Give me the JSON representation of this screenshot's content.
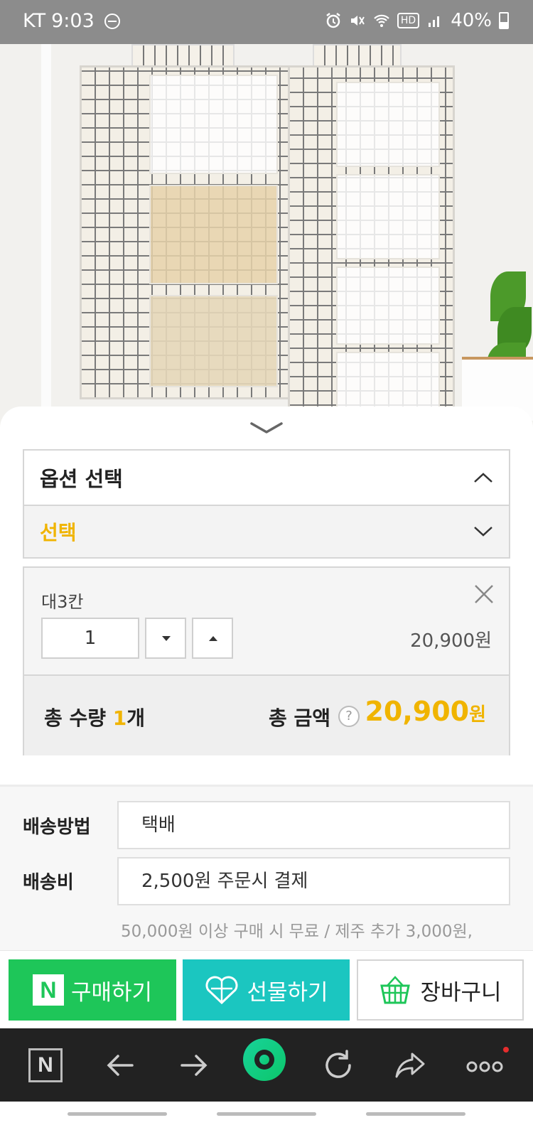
{
  "status_bar": {
    "carrier": "KT",
    "time": "9:03",
    "hd_badge": "HD",
    "battery": "40%"
  },
  "sheet": {
    "option_header": "옵션 선택",
    "option_select_placeholder": "선택",
    "item": {
      "name": "대3칸",
      "quantity": "1",
      "price": "20,900원"
    },
    "total": {
      "qty_label_prefix": "총 수량 ",
      "qty_value": "1",
      "qty_unit": "개",
      "amount_label": "총 금액",
      "help_glyph": "?",
      "amount_value": "20,900",
      "amount_unit": "원"
    }
  },
  "delivery": {
    "method_label": "배송방법",
    "method_value": "택배",
    "fee_label": "배송비",
    "fee_value": "2,500원 주문시 결제",
    "note": "50,000원 이상 구매 시 무료 / 제주 추가 3,000원,"
  },
  "actions": {
    "buy_logo": "N",
    "buy_label": "구매하기",
    "gift_label": "선물하기",
    "cart_label": "장바구니"
  },
  "colors": {
    "accent_yellow": "#f0b400",
    "naver_green": "#1ec659",
    "gift_teal": "#1bc6c0"
  },
  "browser_bar": {
    "home_logo": "N",
    "icons": [
      "naver-home-icon",
      "back-arrow-icon",
      "forward-arrow-icon",
      "green-dot-icon",
      "refresh-icon",
      "share-icon",
      "more-icon"
    ]
  }
}
